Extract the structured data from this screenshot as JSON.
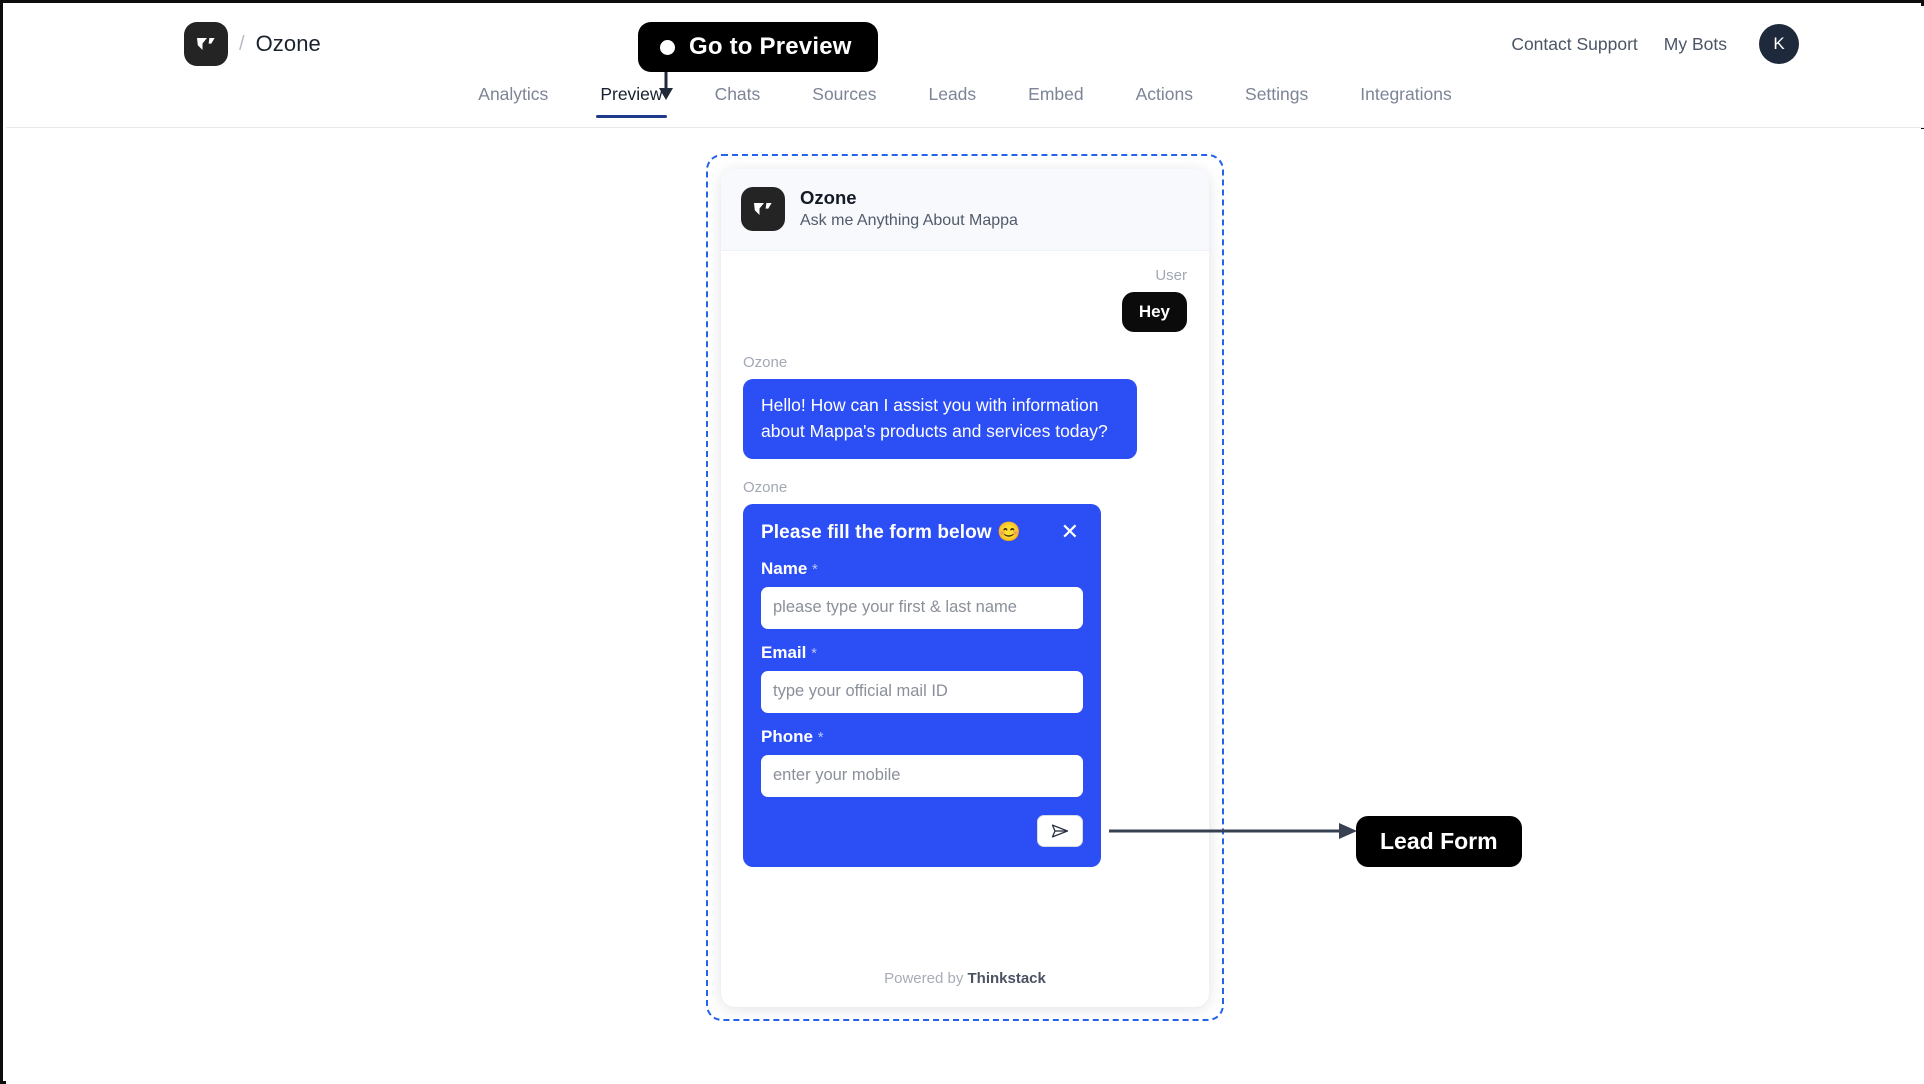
{
  "header": {
    "brand_separator": "/",
    "bot_name": "Ozone",
    "logo_icon": "thinkstack-logo-icon",
    "links": [
      {
        "label": "Contact Support"
      },
      {
        "label": "My Bots"
      }
    ],
    "avatar_initial": "K"
  },
  "nav": {
    "items": [
      {
        "label": "Analytics",
        "active": false
      },
      {
        "label": "Preview",
        "active": true
      },
      {
        "label": "Chats",
        "active": false
      },
      {
        "label": "Sources",
        "active": false
      },
      {
        "label": "Leads",
        "active": false
      },
      {
        "label": "Embed",
        "active": false
      },
      {
        "label": "Actions",
        "active": false
      },
      {
        "label": "Settings",
        "active": false
      },
      {
        "label": "Integrations",
        "active": false
      }
    ]
  },
  "callouts": {
    "preview_tooltip": "Go to Preview",
    "lead_form_label": "Lead Form"
  },
  "widget": {
    "bot_name": "Ozone",
    "bot_subtitle": "Ask me Anything About Mappa",
    "avatar_icon": "thinkstack-logo-icon",
    "messages": [
      {
        "sender_label": "User",
        "side": "user",
        "text": "Hey"
      },
      {
        "sender_label": "Ozone",
        "side": "bot",
        "text": "Hello! How can I assist you with information about Mappa's products and services today?"
      }
    ],
    "form_sender_label": "Ozone",
    "lead_form": {
      "title": "Please fill the form below 😊",
      "close_icon": "close-icon",
      "required_mark": "*",
      "fields": [
        {
          "label": "Name",
          "placeholder": "please type your first & last name",
          "value": ""
        },
        {
          "label": "Email",
          "placeholder": "type your official mail ID",
          "value": ""
        },
        {
          "label": "Phone",
          "placeholder": "enter your mobile",
          "value": ""
        }
      ],
      "send_icon": "send-icon"
    },
    "footer_prefix": "Powered by ",
    "footer_brand": "Thinkstack"
  },
  "colors": {
    "brand_blue": "#2c4ef5",
    "callout_black": "#000000",
    "dashed_border": "#2563eb",
    "avatar_navy": "#1e293b",
    "arrow_slate": "#374151"
  }
}
